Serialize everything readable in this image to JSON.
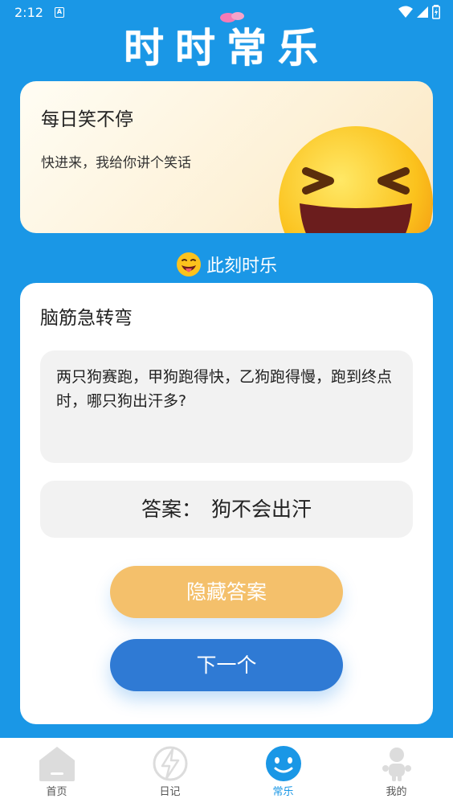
{
  "status_bar": {
    "time": "2:12",
    "indicator": "A"
  },
  "app": {
    "title": "时时常乐"
  },
  "banner": {
    "title": "每日笑不停",
    "subtitle": "快进来，我给你讲个笑话",
    "icon": "laughing-face-emoji"
  },
  "section": {
    "heading": "此刻时乐",
    "icon": "face-with-tongue-emoji"
  },
  "card": {
    "title": "脑筋急转弯",
    "question": "两只狗赛跑，甲狗跑得快，乙狗跑得慢，跑到终点时，哪只狗出汗多?",
    "answer_label": "答案：",
    "answer_value": "狗不会出汗",
    "hide_button": "隐藏答案",
    "next_button": "下一个"
  },
  "nav": {
    "items": [
      {
        "label": "首页",
        "icon": "home-icon",
        "active": false
      },
      {
        "label": "日记",
        "icon": "lightning-icon",
        "active": false
      },
      {
        "label": "常乐",
        "icon": "smile-icon",
        "active": true
      },
      {
        "label": "我的",
        "icon": "person-icon",
        "active": false
      }
    ]
  },
  "colors": {
    "primary": "#1a97e6",
    "hide_button": "#f4c06b",
    "next_button": "#2f7ad4",
    "banner_bg": "#fdf1d7"
  }
}
